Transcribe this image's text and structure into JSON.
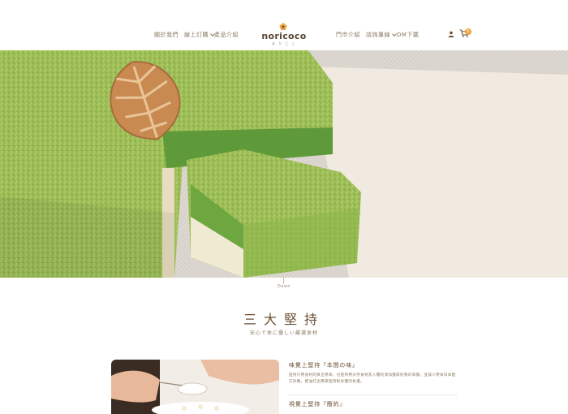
{
  "nav": {
    "left_items": [
      {
        "label": "關於我們",
        "has_dropdown": false
      },
      {
        "label": "線上訂購",
        "has_dropdown": true
      },
      {
        "label": "產品介紹",
        "has_dropdown": false
      }
    ],
    "right_items": [
      {
        "label": "門市介紹",
        "has_dropdown": false
      },
      {
        "label": "諮詢專線",
        "has_dropdown": true
      },
      {
        "label": "DM下載",
        "has_dropdown": false
      }
    ],
    "cart_count": "0"
  },
  "logo": {
    "text": "noricoco",
    "sub": "ま り こ こ"
  },
  "hero": {
    "scroll_label": "Down"
  },
  "section": {
    "title": "三大堅持",
    "subtitle": "安心で体に優しい厳選食材"
  },
  "features": [
    {
      "title": "味覺上堅持『本間の味』",
      "body": "堅持只用食材的真正原味，也堅持用天然食材及入體的添加獲取好我的味覺，並減少原本日本配方砂糖，把油打出用來堅持對身體的負擔。"
    },
    {
      "title": "視覺上堅持『簡約』"
    }
  ],
  "colors": {
    "brand_brown": "#6a4f33",
    "accent_orange": "#e9a43a",
    "matcha_green": "#8fb24a"
  }
}
